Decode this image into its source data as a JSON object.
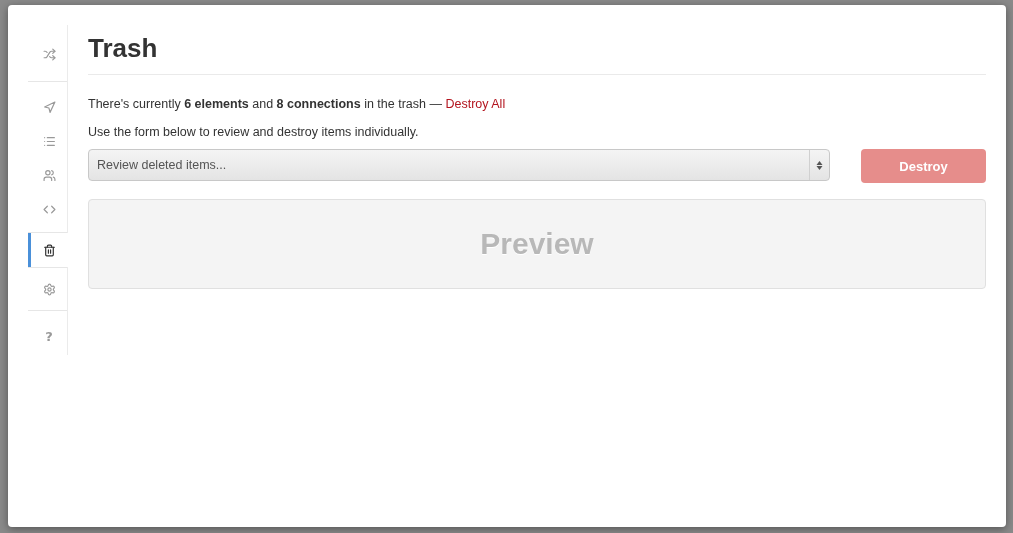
{
  "sidebar": {
    "groups": [
      [
        {
          "kind": "shuffle",
          "selected": false
        }
      ],
      [
        {
          "kind": "navigate",
          "selected": false
        },
        {
          "kind": "list",
          "selected": false
        },
        {
          "kind": "users",
          "selected": false
        },
        {
          "kind": "code",
          "selected": false
        }
      ],
      [
        {
          "kind": "trash",
          "selected": true
        }
      ],
      [
        {
          "kind": "settings",
          "selected": false
        }
      ],
      [
        {
          "kind": "help",
          "selected": false,
          "label": "?"
        }
      ]
    ]
  },
  "title": "Trash",
  "summary": "There's currently **6 elements** and **8 connections** in the trash —",
  "destroy_all_link": "Destroy All",
  "instructions": "Use the form below to review and destroy items individually.",
  "select": {
    "value": "Review deleted items..."
  },
  "destroy_button": {
    "label": "Destroy",
    "disabled": true
  },
  "preview": {
    "label": "Preview"
  }
}
